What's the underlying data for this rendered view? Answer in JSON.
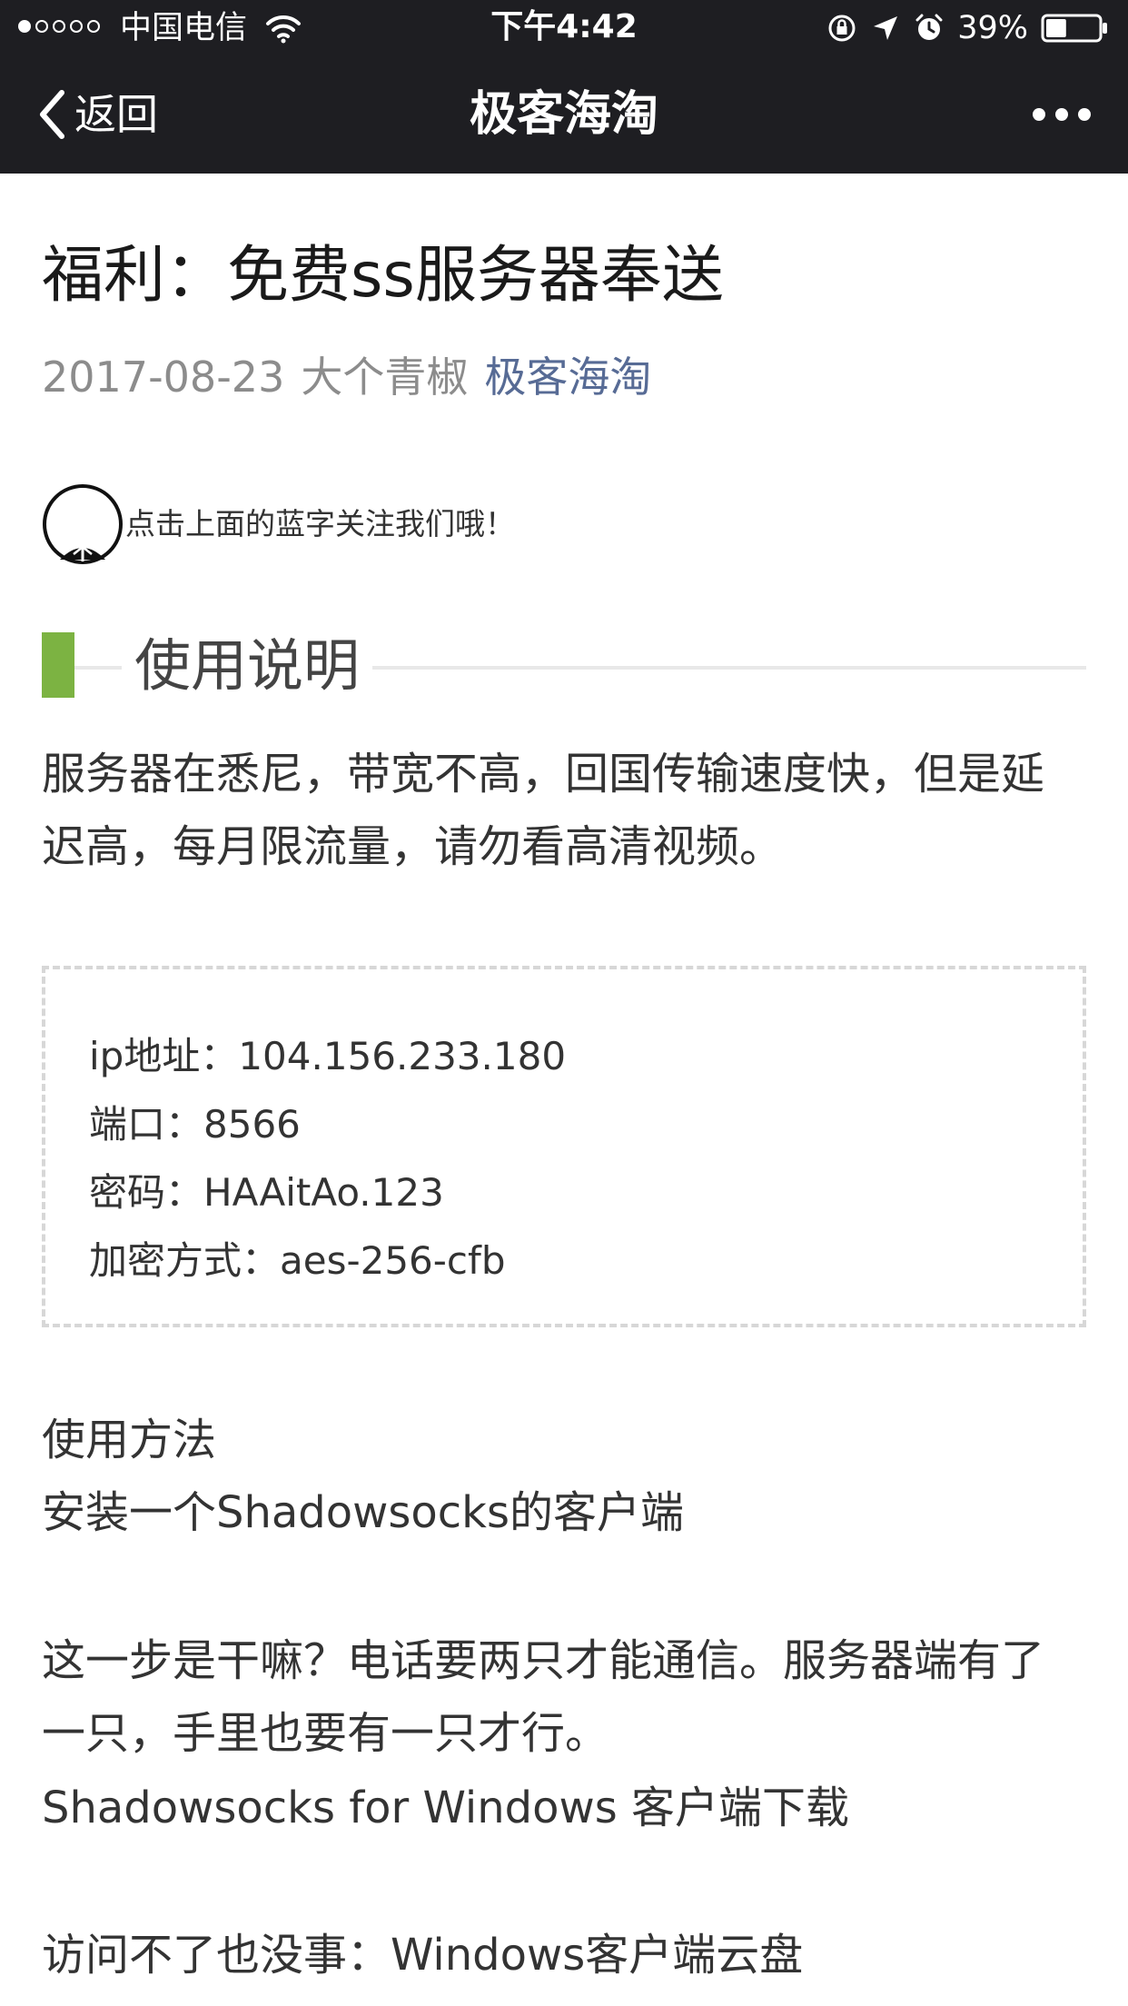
{
  "status_bar": {
    "carrier": "中国电信",
    "time": "下午4:42",
    "battery": "39%",
    "battery_level": 0.39,
    "signal_bars_filled": 1,
    "signal_bars_total": 5
  },
  "nav": {
    "back_label": "返回",
    "title": "极客海淘"
  },
  "article": {
    "title": "福利：免费ss服务器奉送",
    "date": "2017-08-23",
    "author": "大个青椒",
    "account": "极客海淘",
    "follow_prompt": "点击上面的蓝字关注我们哦！",
    "section_title": "使用说明",
    "intro": "服务器在悉尼，带宽不高，回国传输速度快，但是延迟高，每月限流量，请勿看高清视频。",
    "server_info": [
      "ip地址：104.156.233.180",
      "端口：8566",
      "密码：HAAitAo.123",
      "加密方式：aes-256-cfb"
    ],
    "usage_title": "使用方法",
    "usage_sub": "安装一个Shadowsocks的客户端",
    "explanation": "这一步是干嘛？电话要两只才能通信。服务器端有了一只，手里也要有一只才行。",
    "download_link": "Shadowsocks for Windows 客户端下载",
    "cloud_link": "访问不了也没事：Windows客户端云盘"
  },
  "colors": {
    "nav_background": "#1e1e22",
    "link_blue": "#576b95",
    "section_accent": "#7cb342",
    "meta_gray": "#8c8c8c"
  },
  "icons": [
    "wifi-icon",
    "lock-rotation-icon",
    "location-arrow-icon",
    "alarm-icon",
    "battery-icon",
    "chevron-left-icon",
    "more-dots-icon",
    "follow-circle-icon"
  ]
}
